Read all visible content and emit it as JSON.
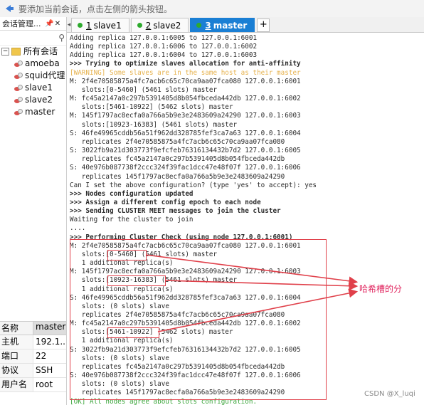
{
  "topbar": {
    "hint": "要添加当前会话，点击左侧的箭头按钮。"
  },
  "session_panel": {
    "title": "会话管理...",
    "pin_icon": "pin-icon",
    "close_icon": "close-icon",
    "search_icon": "search-icon",
    "root": "所有会话",
    "items": [
      "amoeba",
      "squid代理",
      "slave1",
      "slave2",
      "master"
    ]
  },
  "properties": {
    "headers": [
      "名称",
      "master"
    ],
    "rows": [
      {
        "k": "主机",
        "v": "192.1..."
      },
      {
        "k": "端口",
        "v": "22"
      },
      {
        "k": "协议",
        "v": "SSH"
      },
      {
        "k": "用户名",
        "v": "root"
      }
    ]
  },
  "tabs": [
    {
      "num": "1",
      "label": "slave1",
      "active": false
    },
    {
      "num": "2",
      "label": "slave2",
      "active": false
    },
    {
      "num": "3",
      "label": "master",
      "active": true
    }
  ],
  "terminal": {
    "lines": [
      {
        "t": "Adding replica 127.0.0.1:6005 to 127.0.0.1:6001",
        "s": ""
      },
      {
        "t": "Adding replica 127.0.0.1:6006 to 127.0.0.1:6002",
        "s": ""
      },
      {
        "t": "Adding replica 127.0.0.1:6004 to 127.0.0.1:6003",
        "s": ""
      },
      {
        "t": ">>> Trying to optimize slaves allocation for anti-affinity",
        "s": "b"
      },
      {
        "t": "[WARNING] Some slaves are in the same host as their master",
        "s": "warn"
      },
      {
        "t": "M: 2f4e70585875a4fc7acb6c65c70ca9aa07fca080 127.0.0.1:6001",
        "s": ""
      },
      {
        "t": "   slots:[0-5460] (5461 slots) master",
        "s": ""
      },
      {
        "t": "M: fc45a2147a0c297b5391405d8b054fbceda442db 127.0.0.1:6002",
        "s": ""
      },
      {
        "t": "   slots:[5461-10922] (5462 slots) master",
        "s": ""
      },
      {
        "t": "M: 145f1797ac8ecfa0a766a5b9e3e2483609a24290 127.0.0.1:6003",
        "s": ""
      },
      {
        "t": "   slots:[10923-16383] (5461 slots) master",
        "s": ""
      },
      {
        "t": "S: 46fe49965cddb56a51f962dd328785fef3ca7a63 127.0.0.1:6004",
        "s": ""
      },
      {
        "t": "   replicates 2f4e70585875a4fc7acb6c65c70ca9aa07fca080",
        "s": ""
      },
      {
        "t": "S: 3022fb9a21d303773f9efcfeb76316134432b7d2 127.0.0.1:6005",
        "s": ""
      },
      {
        "t": "   replicates fc45a2147a0c297b5391405d8b054fbceda442db",
        "s": ""
      },
      {
        "t": "S: 40e976b087738f2ccc324f39fac1dcc47e48f07f 127.0.0.1:6006",
        "s": ""
      },
      {
        "t": "   replicates 145f1797ac8ecfa0a766a5b9e3e2483609a24290",
        "s": ""
      },
      {
        "t": "Can I set the above configuration? (type 'yes' to accept): yes",
        "s": ""
      },
      {
        "t": ">>> Nodes configuration updated",
        "s": "b"
      },
      {
        "t": ">>> Assign a different config epoch to each node",
        "s": "b"
      },
      {
        "t": ">>> Sending CLUSTER MEET messages to join the cluster",
        "s": "b"
      },
      {
        "t": "Waiting for the cluster to join",
        "s": ""
      },
      {
        "t": "....",
        "s": ""
      },
      {
        "t": ">>> Performing Cluster Check (using node 127.0.0.1:6001)",
        "s": "b"
      },
      {
        "t": "M: 2f4e70585875a4fc7acb6c65c70ca9aa07fca080 127.0.0.1:6001",
        "s": ""
      },
      {
        "t": "   slots:[0-5460] (5461 slots) master",
        "s": ""
      },
      {
        "t": "   1 additional replica(s)",
        "s": ""
      },
      {
        "t": "M: 145f1797ac8ecfa0a766a5b9e3e2483609a24290 127.0.0.1:6003",
        "s": ""
      },
      {
        "t": "   slots:[10923-16383] (5461 slots) master",
        "s": ""
      },
      {
        "t": "   1 additional replica(s)",
        "s": ""
      },
      {
        "t": "S: 46fe49965cddb56a51f962dd328785fef3ca7a63 127.0.0.1:6004",
        "s": ""
      },
      {
        "t": "   slots: (0 slots) slave",
        "s": ""
      },
      {
        "t": "   replicates 2f4e70585875a4fc7acb6c65c70ca9aa07fca080",
        "s": ""
      },
      {
        "t": "M: fc45a2147a0c297b5391405d8b054fbceda442db 127.0.0.1:6002",
        "s": ""
      },
      {
        "t": "   slots:[5461-10922] (5462 slots) master",
        "s": ""
      },
      {
        "t": "   1 additional replica(s)",
        "s": ""
      },
      {
        "t": "S: 3022fb9a21d303773f9efcfeb76316134432b7d2 127.0.0.1:6005",
        "s": ""
      },
      {
        "t": "   slots: (0 slots) slave",
        "s": ""
      },
      {
        "t": "   replicates fc45a2147a0c297b5391405d8b054fbceda442db",
        "s": ""
      },
      {
        "t": "S: 40e976b087738f2ccc324f39fac1dcc47e48f07f 127.0.0.1:6006",
        "s": ""
      },
      {
        "t": "   slots: (0 slots) slave",
        "s": ""
      },
      {
        "t": "   replicates 145f1797ac8ecfa0a766a5b9e3e2483609a24290",
        "s": ""
      },
      {
        "t": "[OK] All nodes agree about slots configuration.",
        "s": "ok"
      }
    ]
  },
  "annotation": {
    "label": "哈希槽的分",
    "color": "#e0245e"
  },
  "watermark": "CSDN @X_luqi",
  "colors": {
    "accent": "#1a7fd4",
    "highlight": "#e0404a",
    "warning": "#e6b24d",
    "ok": "#3aa53a"
  }
}
